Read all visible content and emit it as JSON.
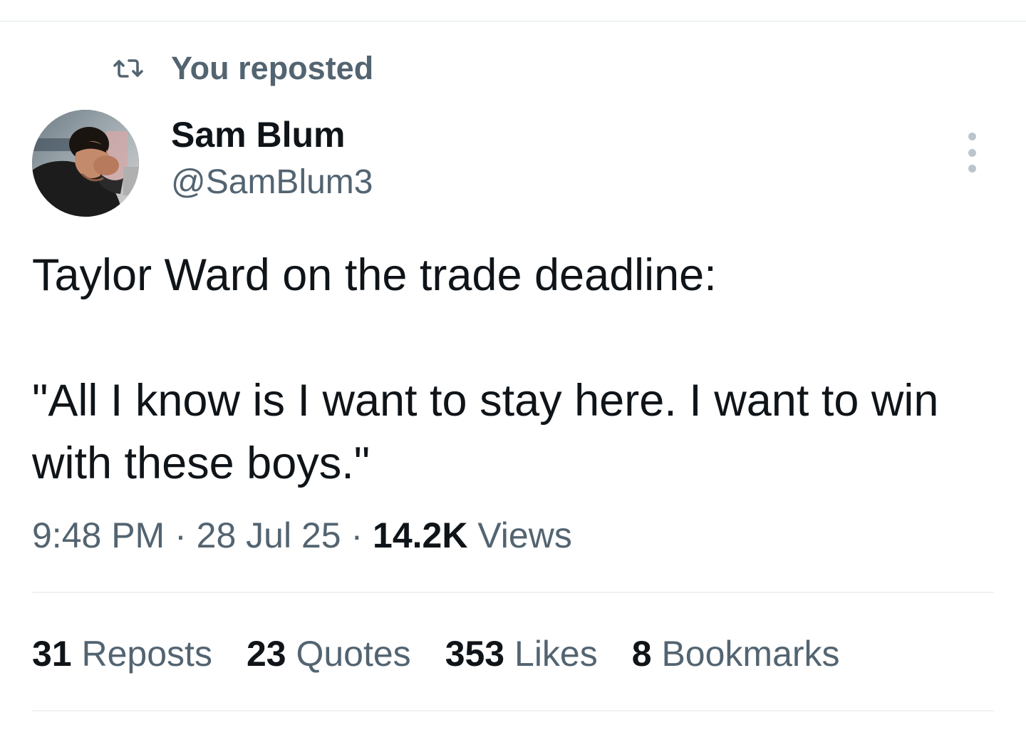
{
  "repost_header": {
    "icon": "repost-icon",
    "label": "You reposted"
  },
  "author": {
    "name": "Sam Blum",
    "handle": "@SamBlum3",
    "avatar": "avatar-photo"
  },
  "more_button": {
    "icon": "more-vertical-icon"
  },
  "tweet": {
    "line1": "Taylor Ward on the trade deadline:",
    "line2": "\"All I know is I want to stay here. I want to win with these boys.\""
  },
  "meta": {
    "time": "9:48 PM",
    "separator1": " · ",
    "date": "28 Jul 25",
    "separator2": " · ",
    "views_count": "14.2K",
    "views_label": " Views"
  },
  "stats": [
    {
      "count": "31",
      "label": " Reposts"
    },
    {
      "count": "23",
      "label": " Quotes"
    },
    {
      "count": "353",
      "label": " Likes"
    },
    {
      "count": "8",
      "label": " Bookmarks"
    }
  ],
  "colors": {
    "text_primary": "#0f1419",
    "text_secondary": "#536471",
    "divider": "#eff3f4",
    "background": "#ffffff"
  }
}
